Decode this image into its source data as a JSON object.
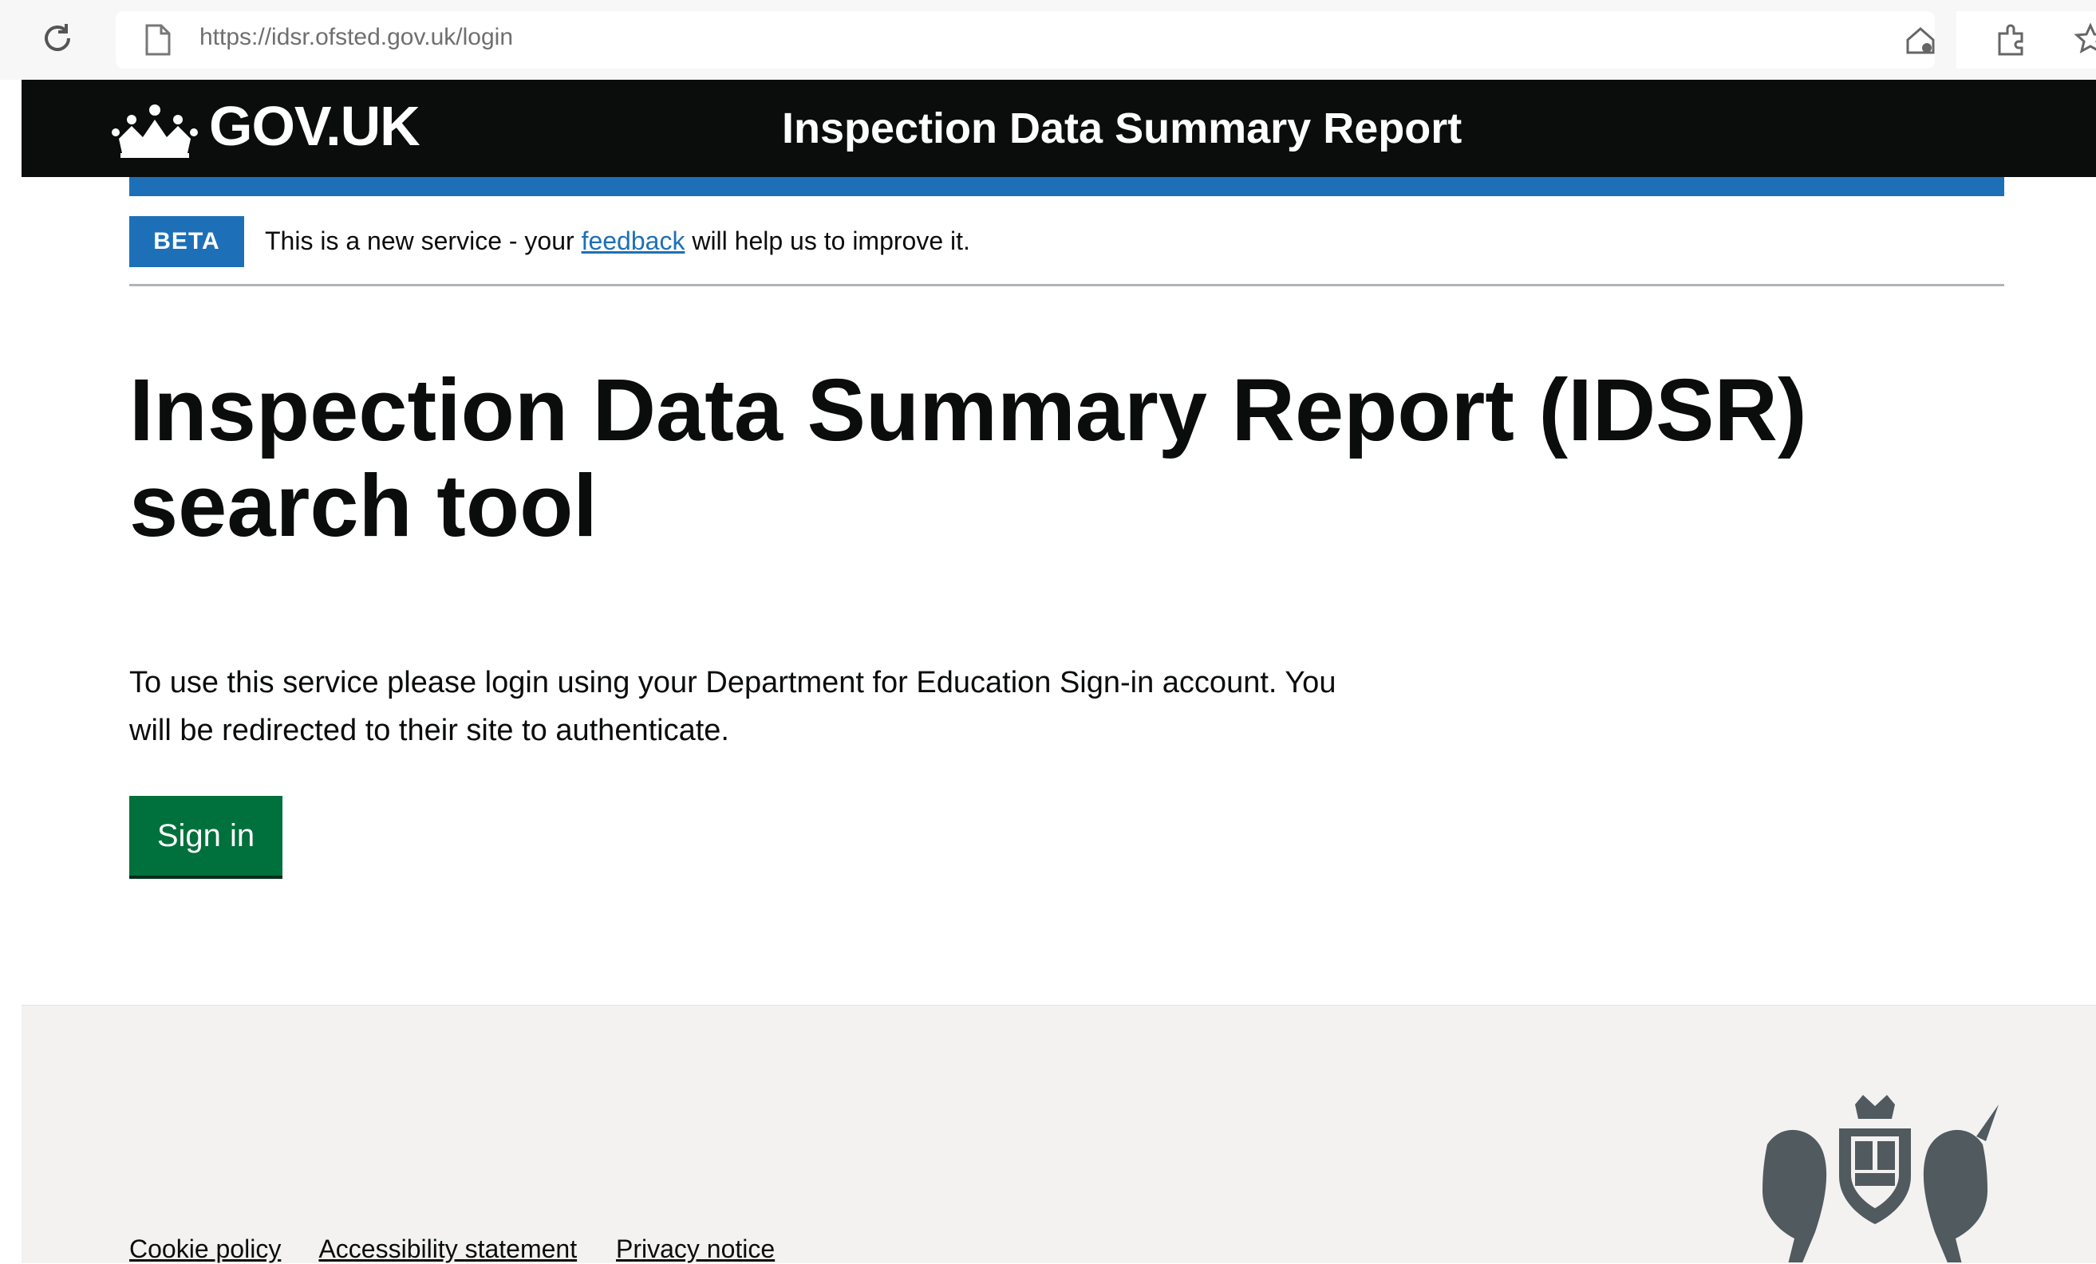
{
  "browser": {
    "url": "https://idsr.ofsted.gov.uk/login"
  },
  "header": {
    "logo_text": "GOV.UK",
    "service_name": "Inspection Data Summary Report"
  },
  "phase_banner": {
    "tag": "BETA",
    "text_before": "This is a new service - your ",
    "link_text": "feedback",
    "text_after": " will help us to improve it."
  },
  "main": {
    "title": "Inspection Data Summary Report (IDSR) search tool",
    "body": "To use this service please login using your Department for Education Sign-in account. You will be redirected to their site to authenticate.",
    "sign_in_label": "Sign in"
  },
  "footer": {
    "links": [
      "Cookie policy",
      "Accessibility statement",
      "Privacy notice"
    ]
  },
  "icons": {
    "reload": "reload-icon",
    "page": "page-info-icon",
    "crown": "crown-icon",
    "coat_of_arms": "royal-coat-of-arms-icon"
  },
  "colors": {
    "header_bg": "#0b0c0c",
    "brand_blue": "#1d70b8",
    "button_green": "#00703c",
    "footer_bg": "#f3f2f1"
  }
}
